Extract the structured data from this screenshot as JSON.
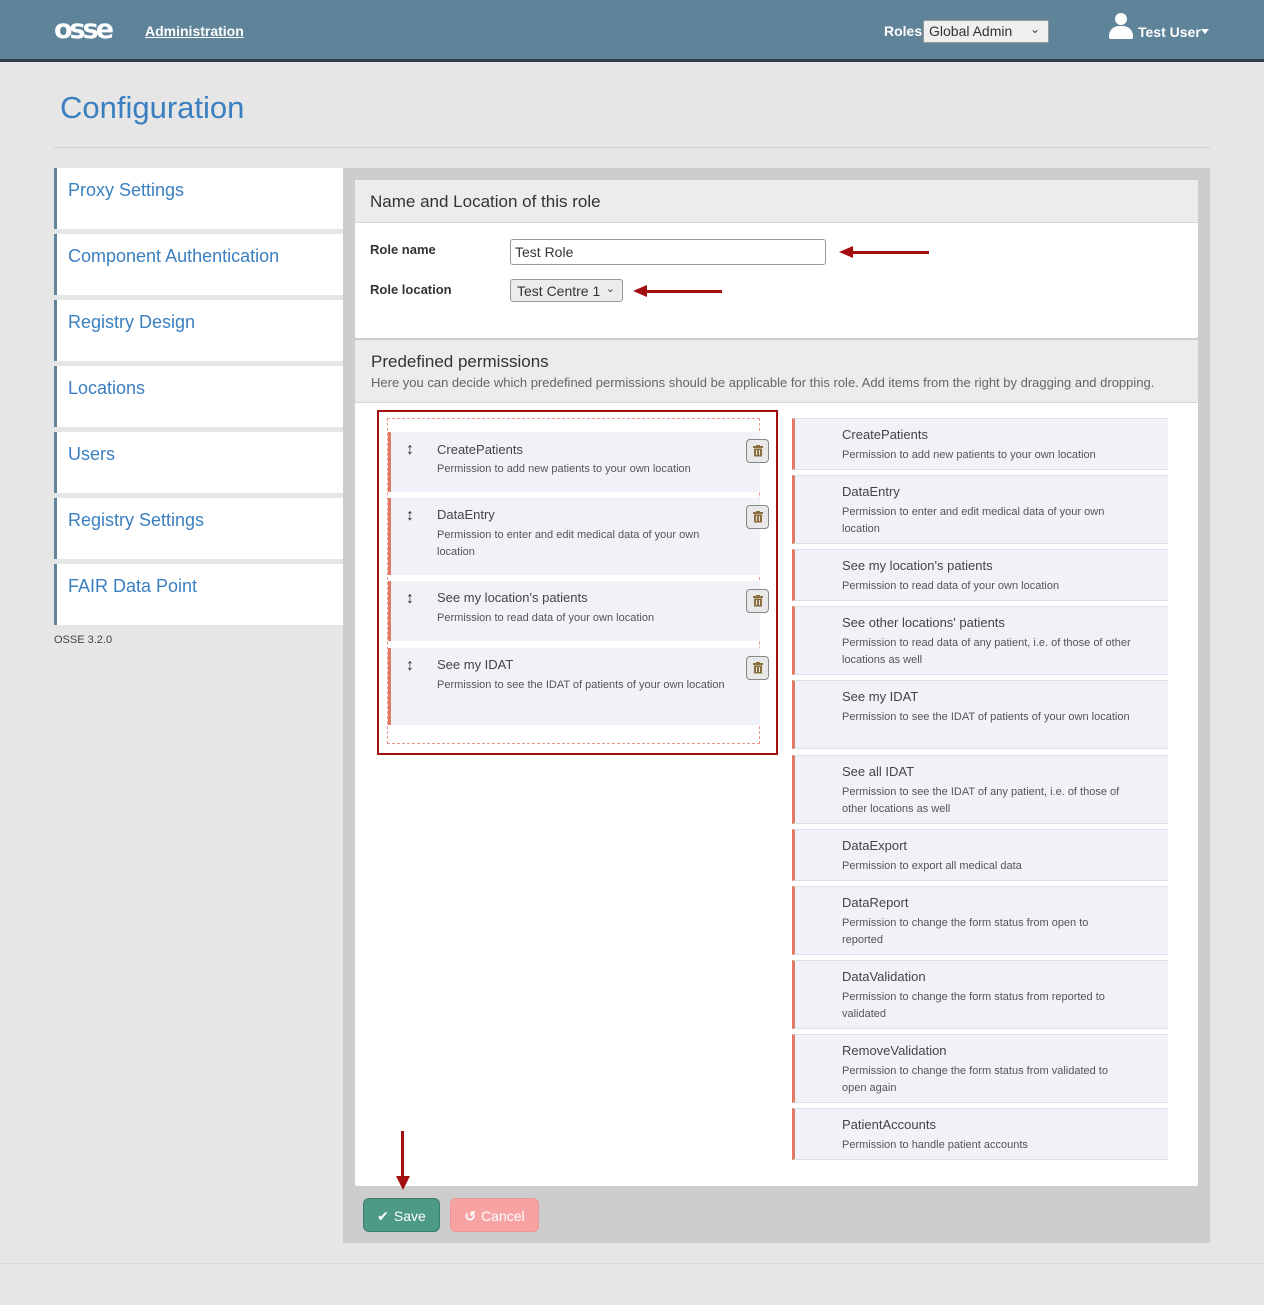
{
  "header": {
    "logo": "osse",
    "admin_link": "Administration",
    "roles_label": "Roles",
    "roles_value": "Global Admin",
    "user_name": "Test User"
  },
  "page": {
    "title": "Configuration"
  },
  "sidebar": {
    "items": [
      {
        "label": "Proxy Settings"
      },
      {
        "label": "Component Authentication"
      },
      {
        "label": "Registry Design"
      },
      {
        "label": "Locations"
      },
      {
        "label": "Users"
      },
      {
        "label": "Registry Settings"
      },
      {
        "label": "FAIR Data Point"
      }
    ],
    "version": "OSSE 3.2.0"
  },
  "role_section": {
    "title": "Name and Location of this role",
    "name_label": "Role name",
    "name_value": "Test Role",
    "location_label": "Role location",
    "location_value": "Test Centre 1"
  },
  "permissions_section": {
    "title": "Predefined permissions",
    "description": "Here you can decide which predefined permissions should be applicable for this role. Add items from the right by dragging and dropping."
  },
  "selected_permissions": [
    {
      "title": "CreatePatients",
      "desc": "Permission to add new patients to your own location"
    },
    {
      "title": "DataEntry",
      "desc": "Permission to enter and edit medical data of your own location"
    },
    {
      "title": "See my location's patients",
      "desc": "Permission to read data of your own location"
    },
    {
      "title": "See my IDAT",
      "desc": "Permission to see the IDAT of patients of your own location"
    }
  ],
  "available_permissions": [
    {
      "title": "CreatePatients",
      "desc": "Permission to add new patients to your own location"
    },
    {
      "title": "DataEntry",
      "desc": "Permission to enter and edit medical data of your own location"
    },
    {
      "title": "See my location's patients",
      "desc": "Permission to read data of your own location"
    },
    {
      "title": "See other locations' patients",
      "desc": "Permission to read data of any patient, i.e. of those of other locations as well"
    },
    {
      "title": "See my IDAT",
      "desc": "Permission to see the IDAT of patients of your own location"
    },
    {
      "title": "See all IDAT",
      "desc": "Permission to see the IDAT of any patient, i.e. of those of other locations as well"
    },
    {
      "title": "DataExport",
      "desc": "Permission to export all medical data"
    },
    {
      "title": "DataReport",
      "desc": "Permission to change the form status from open to reported"
    },
    {
      "title": "DataValidation",
      "desc": "Permission to change the form status from reported to validated"
    },
    {
      "title": "RemoveValidation",
      "desc": "Permission to change the form status from validated to open again"
    },
    {
      "title": "PatientAccounts",
      "desc": "Permission to handle patient accounts"
    }
  ],
  "buttons": {
    "save": "Save",
    "cancel": "Cancel"
  },
  "colors": {
    "header_bg": "#5f8399",
    "link": "#3a7fc0",
    "save": "#4d9a86",
    "cancel": "#f7a3a3",
    "annotation": "#a30f0f",
    "item_accent": "#e07a67"
  },
  "icons": [
    "user-icon",
    "drag-handle-icon",
    "trash-icon",
    "check-icon",
    "undo-icon",
    "chevron-down-icon"
  ]
}
